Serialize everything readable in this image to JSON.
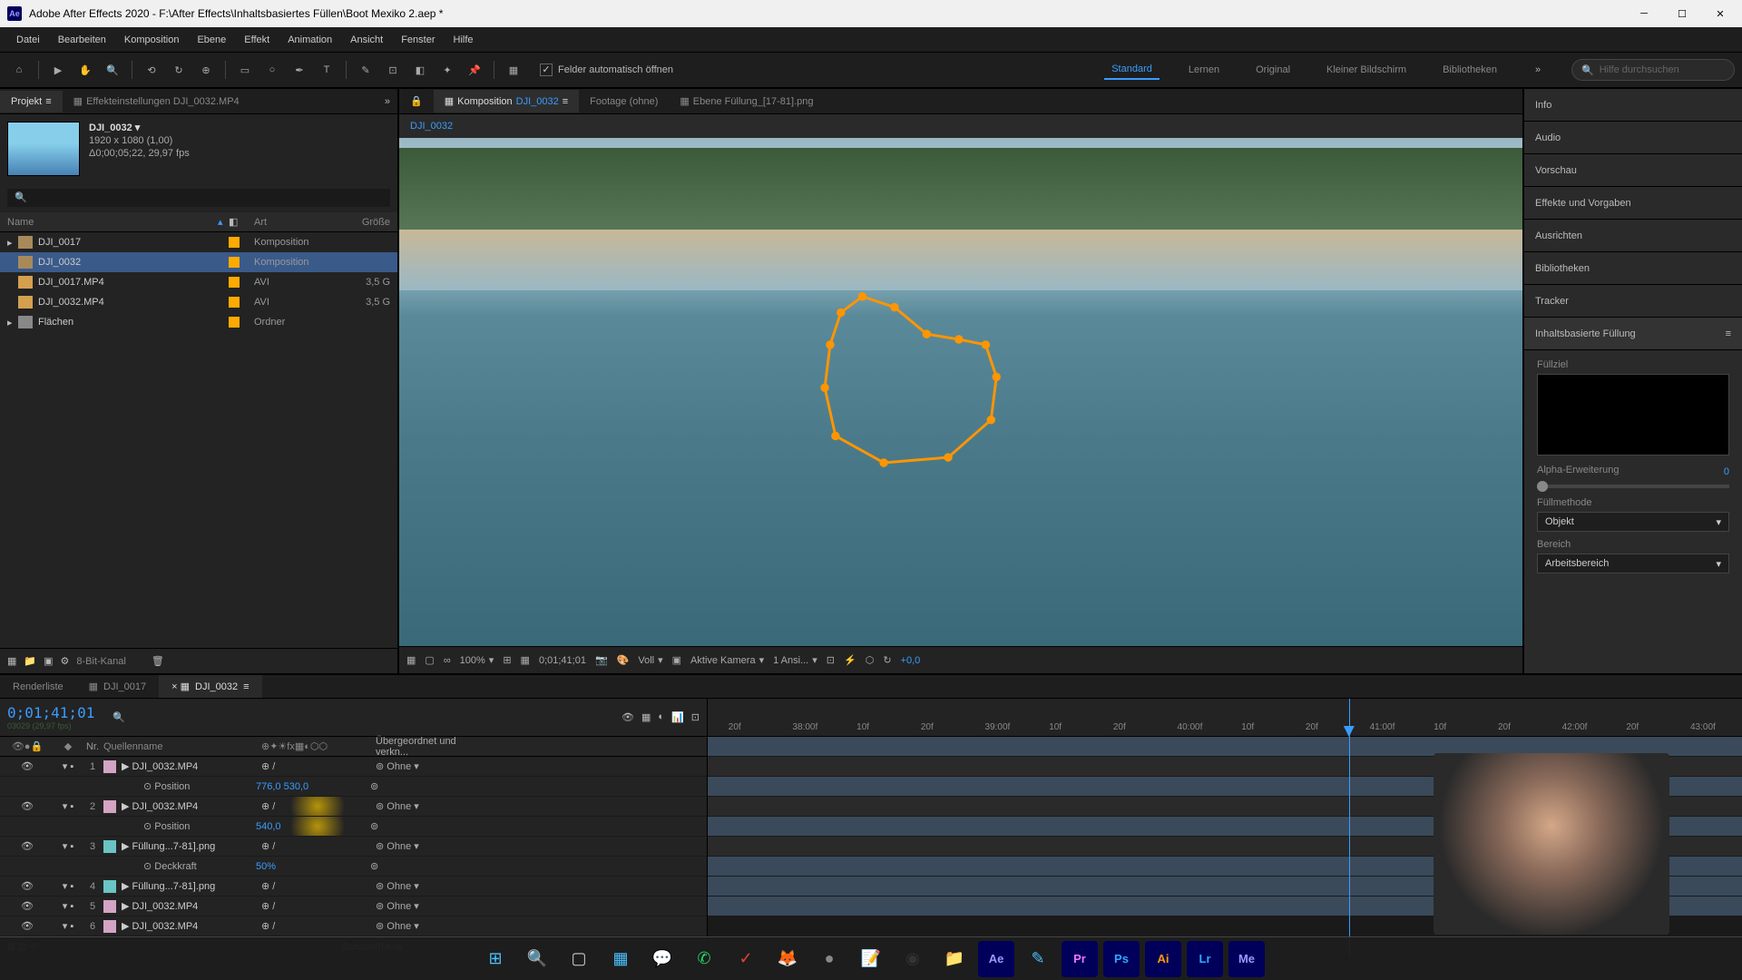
{
  "titlebar": {
    "app_icon": "Ae",
    "title": "Adobe After Effects 2020 - F:\\After Effects\\Inhaltsbasiertes Füllen\\Boot Mexiko 2.aep *"
  },
  "menu": [
    "Datei",
    "Bearbeiten",
    "Komposition",
    "Ebene",
    "Effekt",
    "Animation",
    "Ansicht",
    "Fenster",
    "Hilfe"
  ],
  "toolbar": {
    "checkbox_label": "Felder automatisch öffnen",
    "workspaces": [
      "Standard",
      "Lernen",
      "Original",
      "Kleiner Bildschirm",
      "Bibliotheken"
    ],
    "active_workspace": "Standard",
    "search_placeholder": "Hilfe durchsuchen"
  },
  "project": {
    "tabs": {
      "project": "Projekt",
      "effect_controls": "Effekteinstellungen DJI_0032.MP4"
    },
    "comp_name": "DJI_0032",
    "comp_res": "1920 x 1080 (1,00)",
    "comp_dur": "Δ0;00;05;22, 29,97 fps",
    "cols": {
      "name": "Name",
      "type": "Art",
      "size": "Größe"
    },
    "items": [
      {
        "name": "DJI_0017",
        "type": "Komposition",
        "size": "",
        "icon": "comp",
        "selected": false,
        "has_twirl": true
      },
      {
        "name": "DJI_0032",
        "type": "Komposition",
        "size": "",
        "icon": "comp",
        "selected": true,
        "has_twirl": false
      },
      {
        "name": "DJI_0017.MP4",
        "type": "AVI",
        "size": "3,5 G",
        "icon": "vid",
        "selected": false,
        "has_twirl": false
      },
      {
        "name": "DJI_0032.MP4",
        "type": "AVI",
        "size": "3,5 G",
        "icon": "vid",
        "selected": false,
        "has_twirl": false
      },
      {
        "name": "Flächen",
        "type": "Ordner",
        "size": "",
        "icon": "folder",
        "selected": false,
        "has_twirl": true
      }
    ],
    "footer_depth": "8-Bit-Kanal"
  },
  "comp_viewer": {
    "tabs": {
      "comp_prefix": "Komposition",
      "comp_name": "DJI_0032",
      "footage": "Footage   (ohne)",
      "layer": "Ebene Füllung_[17-81].png"
    },
    "crumb": "DJI_0032",
    "footer": {
      "zoom": "100%",
      "time": "0;01;41;01",
      "res": "Voll",
      "camera": "Aktive Kamera",
      "view": "1 Ansi...",
      "exposure": "+0,0"
    }
  },
  "right_panels": [
    "Info",
    "Audio",
    "Vorschau",
    "Effekte und Vorgaben",
    "Ausrichten",
    "Bibliotheken",
    "Tracker"
  ],
  "caf": {
    "title": "Inhaltsbasierte Füllung",
    "target_label": "Füllziel",
    "alpha_label": "Alpha-Erweiterung",
    "alpha_value": "0",
    "method_label": "Füllmethode",
    "method_value": "Objekt",
    "range_label": "Bereich",
    "range_value": "Arbeitsbereich"
  },
  "timeline": {
    "tabs": [
      {
        "label": "Renderliste",
        "active": false
      },
      {
        "label": "DJI_0017",
        "active": false
      },
      {
        "label": "DJI_0032",
        "active": true
      }
    ],
    "current_time": "0;01;41;01",
    "frame_info": "03029 (29,97 fps)",
    "cols": {
      "num": "Nr.",
      "source": "Quellenname",
      "parent": "Übergeordnet und verkn..."
    },
    "ruler_ticks": [
      "20f",
      "38:00f",
      "10f",
      "20f",
      "39:00f",
      "10f",
      "20f",
      "40:00f",
      "10f",
      "20f",
      "41:00f",
      "10f",
      "20f",
      "42:00f",
      "20f",
      "43:00f"
    ],
    "layers": [
      {
        "num": "1",
        "name": "DJI_0032.MP4",
        "label": "pink",
        "parent": "Ohne",
        "selected": false
      },
      {
        "prop": "Position",
        "value": "776,0 530,0"
      },
      {
        "num": "2",
        "name": "DJI_0032.MP4",
        "label": "pink",
        "parent": "Ohne",
        "selected": true,
        "highlight": true
      },
      {
        "prop": "Position",
        "value": "540,0",
        "highlight": true
      },
      {
        "num": "3",
        "name": "Füllung...7-81].png",
        "label": "teal",
        "parent": "Ohne",
        "selected": false
      },
      {
        "prop": "Deckkraft",
        "value": "50%"
      },
      {
        "num": "4",
        "name": "Füllung...7-81].png",
        "label": "teal",
        "parent": "Ohne",
        "selected": false
      },
      {
        "num": "5",
        "name": "DJI_0032.MP4",
        "label": "pink",
        "parent": "Ohne",
        "selected": false
      },
      {
        "num": "6",
        "name": "DJI_0032.MP4",
        "label": "pink",
        "parent": "Ohne",
        "selected": false
      }
    ],
    "footer": "Schalter/Modi"
  },
  "taskbar": {
    "icons": [
      {
        "name": "start",
        "glyph": "⊞",
        "color": "#4cc2ff"
      },
      {
        "name": "search",
        "glyph": "🔍",
        "color": "#ccc"
      },
      {
        "name": "taskview",
        "glyph": "▢",
        "color": "#ccc"
      },
      {
        "name": "widgets",
        "glyph": "▦",
        "color": "#4cc2ff"
      },
      {
        "name": "teams",
        "glyph": "💬",
        "color": "#6264a7"
      },
      {
        "name": "whatsapp",
        "glyph": "✆",
        "color": "#25d366"
      },
      {
        "name": "todoist",
        "glyph": "✓",
        "color": "#e44332"
      },
      {
        "name": "firefox",
        "glyph": "🦊",
        "color": "#ff9500"
      },
      {
        "name": "app1",
        "glyph": "●",
        "color": "#888"
      },
      {
        "name": "notes",
        "glyph": "📝",
        "color": "#ffd54f"
      },
      {
        "name": "obs",
        "glyph": "◉",
        "color": "#333"
      },
      {
        "name": "explorer",
        "glyph": "📁",
        "color": "#ffca28"
      },
      {
        "name": "ae",
        "glyph": "Ae",
        "color": "#9999ff"
      },
      {
        "name": "app2",
        "glyph": "✎",
        "color": "#4cc2ff"
      },
      {
        "name": "pr",
        "glyph": "Pr",
        "color": "#ea77ff"
      },
      {
        "name": "ps",
        "glyph": "Ps",
        "color": "#31a8ff"
      },
      {
        "name": "ai",
        "glyph": "Ai",
        "color": "#ff9a00"
      },
      {
        "name": "lr",
        "glyph": "Lr",
        "color": "#31a8ff"
      },
      {
        "name": "me",
        "glyph": "Me",
        "color": "#9999ff"
      }
    ]
  }
}
